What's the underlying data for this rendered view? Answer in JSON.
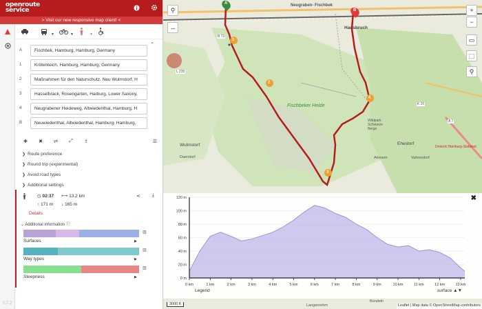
{
  "app": {
    "logo_line1": "openroute",
    "logo_line2": "service",
    "banner": "> Visit our new responsive map client! <",
    "version": "0.7.2"
  },
  "profiles": [
    "car-icon",
    "truck-icon",
    "bike-icon",
    "walking-icon",
    "wheelchair-icon"
  ],
  "waypoints": [
    {
      "index": "A",
      "value": "Fischbek, Hamburg, Hamburg, Germany"
    },
    {
      "index": "1",
      "value": "Krötenteich, Hamburg, Hamburg, Germany"
    },
    {
      "index": "2",
      "value": "Maßnahmen für den Naturschutz, Neu Wulmstorf, H"
    },
    {
      "index": "3",
      "value": "Hasselbrack, Rosengarten, Harburg, Lower Saxony,"
    },
    {
      "index": "4",
      "value": "Neugrabener Heideweg, Altwiedenthal, Hamburg, H"
    },
    {
      "index": "B",
      "value": "Neuwiedenthal, Altwiedenthal, Hamburg, Hamburg,"
    }
  ],
  "options": [
    "Route preference",
    "Round trip (experimental)",
    "Avoid road types",
    "Additional settings"
  ],
  "summary": {
    "time": "02:37",
    "distance": "13.2 km",
    "ascent": "171 m",
    "descent": "165 m",
    "details": "Details",
    "additional_info": "Additional information"
  },
  "info_bars": [
    {
      "label": "Surfaces",
      "segments": [
        {
          "c": "#b9a3d6",
          "w": 28
        },
        {
          "c": "#d7b8e6",
          "w": 20
        },
        {
          "c": "#9cb0e6",
          "w": 52
        }
      ]
    },
    {
      "label": "Way types",
      "segments": [
        {
          "c": "#52b2bd",
          "w": 30
        },
        {
          "c": "#7ec8ce",
          "w": 70
        }
      ]
    },
    {
      "label": "Steepness",
      "segments": [
        {
          "c": "#86e08d",
          "w": 50
        },
        {
          "c": "#e88686",
          "w": 50
        }
      ]
    }
  ],
  "map": {
    "labels": {
      "neugraben": "Neugraben-\nFischbek",
      "hausbruch": "Hausbruch",
      "fischbeker_heide": "Fischbeker\nHeide",
      "wulmstorf": "Wulmstorf",
      "ehestorf": "Ehestorf",
      "alvesen": "Alvesen",
      "vahrendorf": "Vahrendorf",
      "daerstorf": "Daerstorf",
      "wildpark": "Wildpark\nSchwarze\nBerge",
      "road_b73": "B 73",
      "road_l235": "L 235",
      "road_k20": "K 20",
      "road_a7": "A 7",
      "dreieck": "Dreieck Hamburg-Südwest",
      "langenrehm": "Langenrehm",
      "buendel": "Bündeln",
      "markers": [
        "A",
        "1",
        "2",
        "3",
        "4",
        "B"
      ]
    },
    "attribution": "Leaflet | Map data © OpenStreetMap contributors",
    "scale": "3000 ft"
  },
  "elevation": {
    "y_ticks": [
      "120 m",
      "100 m",
      "80 m",
      "60 m",
      "40 m",
      "20 m",
      "0 m"
    ],
    "x_ticks": [
      "0 km",
      "1 km",
      "2 km",
      "3 km",
      "4 km",
      "5 km",
      "6 km",
      "7 km",
      "8 km",
      "9 km",
      "10 km",
      "11 km",
      "12 km",
      "13 km"
    ],
    "legend": "Legend",
    "surface": "surface",
    "chart_data": {
      "type": "area",
      "x": [
        0,
        0.5,
        1,
        1.5,
        2,
        2.5,
        3,
        3.5,
        4,
        4.5,
        5,
        5.5,
        6,
        6.5,
        7,
        7.5,
        8,
        8.5,
        9,
        9.5,
        10,
        10.5,
        11,
        11.5,
        12,
        12.5,
        13,
        13.2
      ],
      "y": [
        10,
        40,
        62,
        68,
        62,
        55,
        58,
        63,
        68,
        76,
        86,
        98,
        108,
        104,
        96,
        90,
        80,
        72,
        60,
        50,
        46,
        48,
        40,
        42,
        38,
        30,
        15,
        10
      ],
      "xlabel": "",
      "ylabel": "",
      "ylim": [
        0,
        120
      ],
      "xlim": [
        0,
        13.2
      ]
    }
  }
}
